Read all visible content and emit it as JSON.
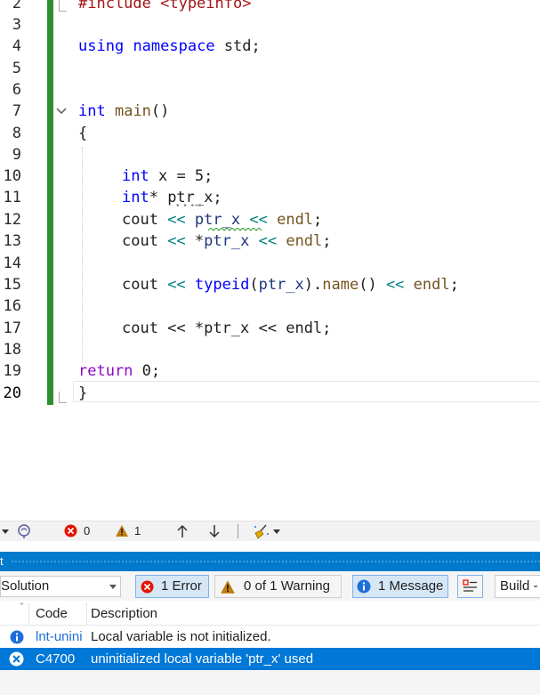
{
  "editor": {
    "line_numbers": [
      "2",
      "3",
      "4",
      "5",
      "6",
      "7",
      "8",
      "9",
      "10",
      "11",
      "12",
      "13",
      "14",
      "15",
      "16",
      "17",
      "18",
      "19",
      "20"
    ],
    "code": {
      "l2_text": "#include <typeinfo>",
      "l4_kw1": "using",
      "l4_kw2": "namespace",
      "l4_rest": "std;",
      "l7_kw": "int",
      "l7_fn": "main",
      "l7_rest": "()",
      "l8": "{",
      "l10_kw": "int",
      "l10_rest": "x = 5;",
      "l11_kw": "int",
      "l11_rest": "* ptr_x;",
      "l12": "cout << ptr_x << endl;",
      "l13": "cout << *ptr_x << endl;",
      "l15": "cout << typeid(ptr_x).name() << endl;",
      "l17": "cout << *ptr_x << endl;",
      "l19_kw": "return",
      "l19_rest": "0;",
      "l20": "}"
    }
  },
  "status_toolbar": {
    "errors_count": "0",
    "warnings_count": "1"
  },
  "error_list": {
    "title": "t",
    "scope_combo": "Solution",
    "errors_btn": "1 Error",
    "warnings_btn": "0 of 1 Warning",
    "messages_btn": "1 Message",
    "build_combo": "Build -",
    "col_code": "Code",
    "col_description": "Description",
    "rows": [
      {
        "code": "lnt-unini",
        "description": "Local variable is not initialized."
      },
      {
        "code": "C4700",
        "description": "uninitialized local variable 'ptr_x' used"
      }
    ]
  },
  "colors": {
    "accent": "#007acc",
    "selection": "#0078d7",
    "change_bar": "#2f8f2f",
    "error": "#e51400",
    "warning": "#c27d0e",
    "info": "#1e6fd9"
  }
}
